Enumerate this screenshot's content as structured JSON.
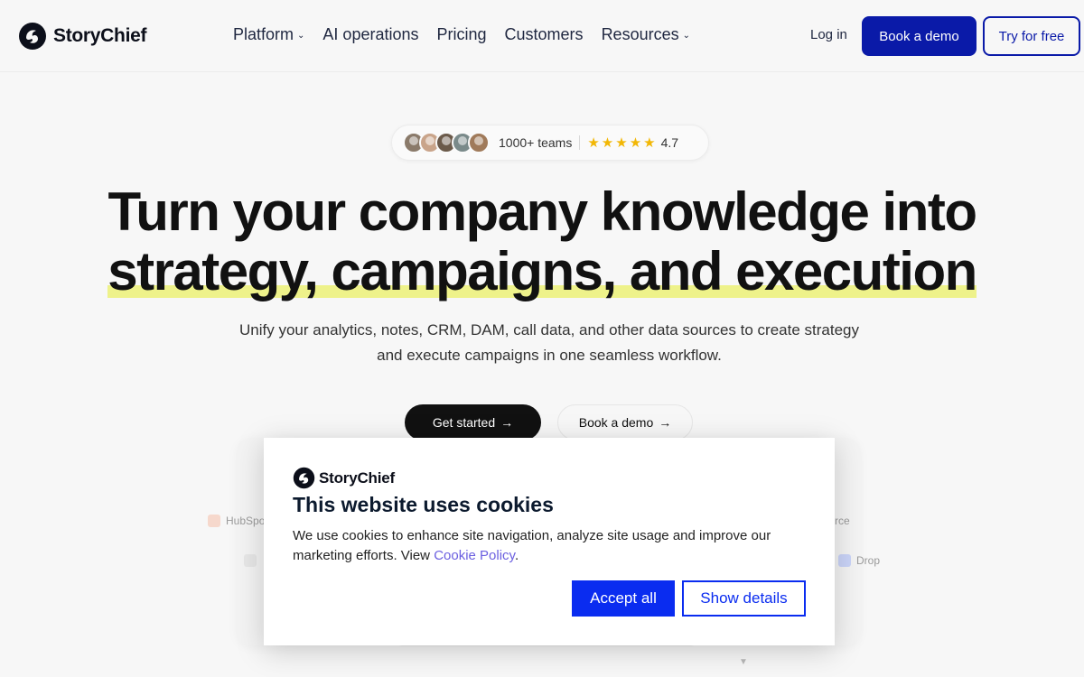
{
  "nav": {
    "brand": "StoryChief",
    "items": [
      {
        "label": "Platform",
        "has_dropdown": true
      },
      {
        "label": "AI operations",
        "has_dropdown": false
      },
      {
        "label": "Pricing",
        "has_dropdown": false
      },
      {
        "label": "Customers",
        "has_dropdown": false
      },
      {
        "label": "Resources",
        "has_dropdown": true
      }
    ],
    "login": "Log in",
    "book_demo": "Book a demo",
    "try_free": "Try for free"
  },
  "proof": {
    "teams": "1000+ teams",
    "rating": "4.7",
    "stars": 5,
    "avatar_colors": [
      "#8a7a6a",
      "#c9a48a",
      "#6b5a4a",
      "#7a8a8a",
      "#a07a5a"
    ]
  },
  "hero": {
    "headline_line1": "Turn your company knowledge into",
    "headline_line2": "strategy, campaigns, and execution",
    "subtitle": "Unify your analytics, notes, CRM, DAM, call data, and other data sources to create strategy and execute campaigns in one seamless workflow.",
    "cta_primary": "Get started",
    "cta_secondary": "Book a demo",
    "highlight_color": "#eef28a"
  },
  "background_integrations": {
    "left_top": "HubSpo",
    "right_top": "rce",
    "right_bottom": "Drop"
  },
  "cookie": {
    "brand": "StoryChief",
    "title": "This website uses cookies",
    "text": "We use cookies to enhance site navigation, analyze site usage and improve our marketing efforts. View",
    "link": "Cookie Policy",
    "accept": "Accept all",
    "details": "Show details",
    "accent_color": "#0a2cf0"
  },
  "colors": {
    "brand_blue": "#0a1aa8",
    "star": "#f2b705"
  }
}
